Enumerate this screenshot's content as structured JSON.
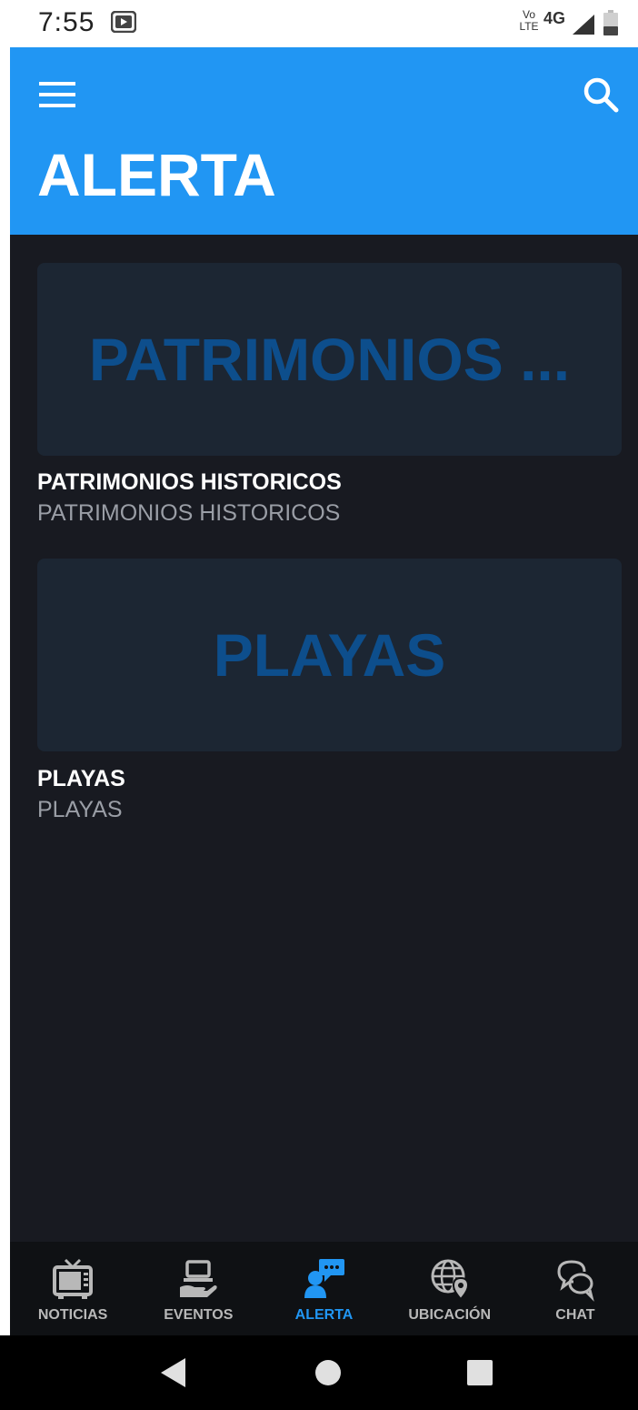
{
  "status_bar": {
    "time": "7:55",
    "volte_line1": "Vo",
    "volte_line2": "LTE",
    "network": "4G"
  },
  "app_bar": {
    "title": "ALERTA"
  },
  "cards": [
    {
      "banner": "PATRIMONIOS ...",
      "title": "PATRIMONIOS HISTORICOS",
      "subtitle": "PATRIMONIOS HISTORICOS"
    },
    {
      "banner": "PLAYAS",
      "title": "PLAYAS",
      "subtitle": "PLAYAS"
    }
  ],
  "bottom_nav": [
    {
      "label": "NOTICIAS",
      "icon": "tv-icon",
      "active": false
    },
    {
      "label": "EVENTOS",
      "icon": "laptop-hand-icon",
      "active": false
    },
    {
      "label": "ALERTA",
      "icon": "person-chat-icon",
      "active": true
    },
    {
      "label": "UBICACIÓN",
      "icon": "globe-pin-icon",
      "active": false
    },
    {
      "label": "CHAT",
      "icon": "chat-bubbles-icon",
      "active": false
    }
  ],
  "colors": {
    "accent": "#2196f3",
    "background": "#181a21",
    "card": "#1c2633",
    "banner_text": "#0d4e8c",
    "nav_background": "#0f1114",
    "nav_inactive": "#b8b8b8"
  }
}
